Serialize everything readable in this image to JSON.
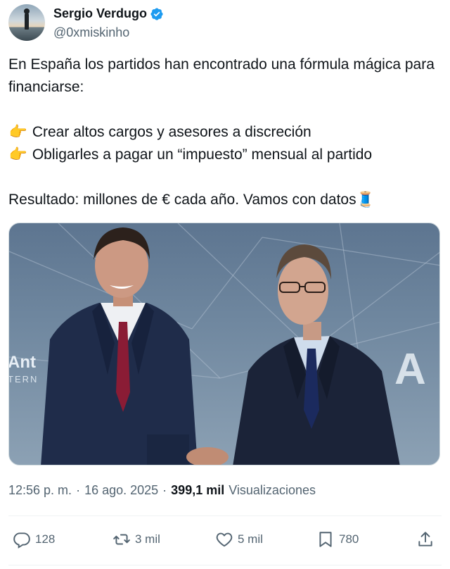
{
  "author": {
    "name": "Sergio Verdugo",
    "handle": "@0xmiskinho"
  },
  "tweet": {
    "line1": "En España los partidos han encontrado una fórmula mágica para financiarse:",
    "bullet_emoji": "👉",
    "bullet1": "Crear altos cargos y asesores a discreción",
    "bullet2": "Obligarles a pagar un “impuesto” mensual al partido",
    "result": "Resultado: millones de € cada año. Vamos con datos",
    "thread_emoji": "🧵"
  },
  "media": {
    "backdrop_text_left": "Ant",
    "backdrop_text_left_sub": "TERN",
    "backdrop_text_right": "A"
  },
  "meta": {
    "time": "12:56 p. m.",
    "separator": "·",
    "date": "16 ago. 2025",
    "views_count": "399,1 mil",
    "views_label": "Visualizaciones"
  },
  "actions": {
    "replies": "128",
    "reposts": "3 mil",
    "likes": "5 mil",
    "bookmarks": "780"
  },
  "colors": {
    "text": "#0f1419",
    "secondary": "#536471",
    "verified": "#1d9bf0"
  }
}
